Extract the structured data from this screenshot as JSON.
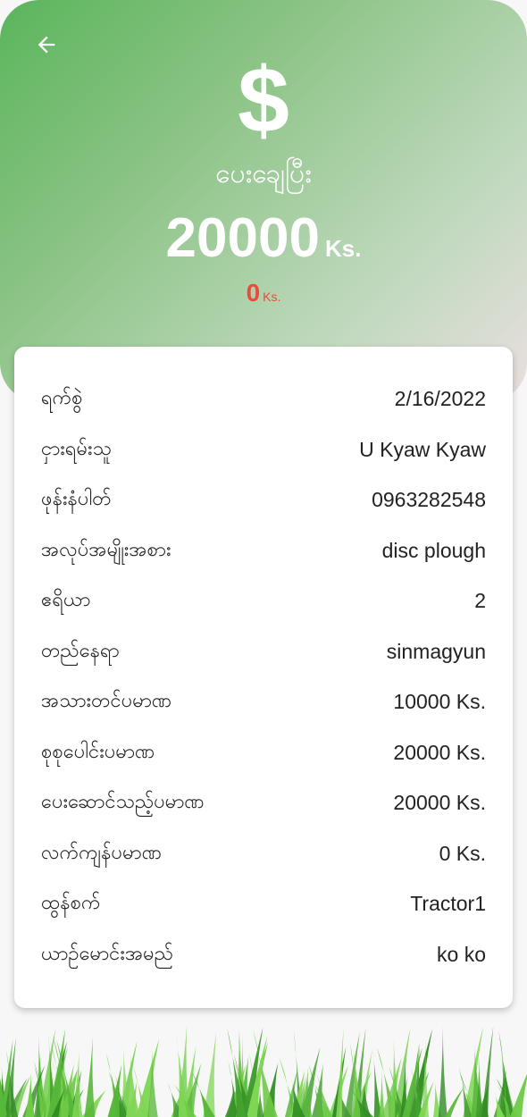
{
  "header": {
    "back_icon": "arrow-left-icon",
    "currency_symbol": "$",
    "status": "ပေးချေပြီး",
    "amount": "20000",
    "amount_unit": "Ks.",
    "balance": "0",
    "balance_unit": "Ks.",
    "balance_color": "#e74c3c"
  },
  "details": [
    {
      "label": "ရက်စွဲ",
      "value": "2/16/2022"
    },
    {
      "label": "ငှားရမ်းသူ",
      "value": "U Kyaw Kyaw"
    },
    {
      "label": "ဖုန်းနံပါတ်",
      "value": "0963282548"
    },
    {
      "label": "အလုပ်အမျိုးအစား",
      "value": "disc plough"
    },
    {
      "label": "ဧရိယာ",
      "value": "2"
    },
    {
      "label": "တည်နေရာ",
      "value": "sinmagyun"
    },
    {
      "label": "အသားတင်ပမာဏ",
      "value": "10000 Ks."
    },
    {
      "label": "စုစုပေါင်းပမာဏ",
      "value": "20000 Ks."
    },
    {
      "label": "ပေးဆောင်သည့်ပမာဏ",
      "value": "20000 Ks."
    },
    {
      "label": "လက်ကျန်ပမာဏ",
      "value": "0 Ks."
    },
    {
      "label": "ထွန်စက်",
      "value": "Tractor1"
    },
    {
      "label": "ယာဉ်မောင်းအမည်",
      "value": "ko ko"
    }
  ],
  "theme": {
    "accent_green": "#5bb55c"
  }
}
